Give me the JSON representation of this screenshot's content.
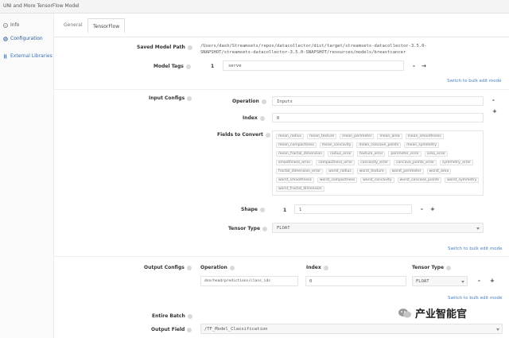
{
  "window": {
    "title": "UNI and More TensorFlow Model"
  },
  "sidebar": {
    "items": [
      {
        "label": "Info",
        "icon": "info-icon"
      },
      {
        "label": "Configuration",
        "icon": "gear-icon"
      },
      {
        "label": "External Libraries",
        "icon": "library-icon"
      }
    ]
  },
  "tabs": [
    {
      "label": "General"
    },
    {
      "label": "TensorFlow"
    }
  ],
  "form": {
    "saved_model_path": {
      "label": "Saved Model Path",
      "value_line1": "/Users/dash/Streamsets/repos/datacollector/dist/target/streamsets-datacollector-3.5.0-",
      "value_line2": "SNAPSHOT/streamsets-datacollector-3.5.0-SNAPSHOT/resources/models/breastcancer"
    },
    "model_tags": {
      "label": "Model Tags",
      "index": "1",
      "value": "serve",
      "link": "Switch to bulk edit mode"
    },
    "input_configs": {
      "label": "Input Configs",
      "operation": {
        "label": "Operation",
        "value": "Inputs"
      },
      "index": {
        "label": "Index",
        "value": "0"
      },
      "fields_to_convert": {
        "label": "Fields to Convert",
        "chips": [
          "mean_radius",
          "mean_texture",
          "mean_perimeter",
          "mean_area",
          "mean_smoothness",
          "mean_compactness",
          "mean_concavity",
          "mean_concave_points",
          "mean_symmetry",
          "mean_fractal_dimension",
          "radius_error",
          "texture_error",
          "perimeter_error",
          "area_error",
          "smoothness_error",
          "compactness_error",
          "concavity_error",
          "concave_points_error",
          "symmetry_error",
          "fractal_dimension_error",
          "worst_radius",
          "worst_texture",
          "worst_perimeter",
          "worst_area",
          "worst_smoothness",
          "worst_compactness",
          "worst_concavity",
          "worst_concave_points",
          "worst_symmetry",
          "worst_fractal_dimension"
        ]
      },
      "shape": {
        "label": "Shape",
        "index": "1",
        "value": "1"
      },
      "tensor_type": {
        "label": "Tensor Type",
        "value": "FLOAT"
      },
      "link": "Switch to bulk edit mode"
    },
    "output_configs": {
      "label": "Output Configs",
      "col_operation": "Operation",
      "col_index": "Index",
      "col_tensor_type": "Tensor Type",
      "operation_value": "dnn/head/predictions/class_ids",
      "index_value": "0",
      "tensor_value": "FLOAT",
      "link": "Switch to bulk edit mode"
    },
    "entire_batch": {
      "label": "Entire Batch"
    },
    "output_field": {
      "label": "Output Field",
      "value": "/TF_Model_Classification"
    }
  },
  "controls": {
    "minus": "-",
    "plus": "+",
    "arrow": "→"
  },
  "watermark": {
    "text": "产业智能官"
  }
}
